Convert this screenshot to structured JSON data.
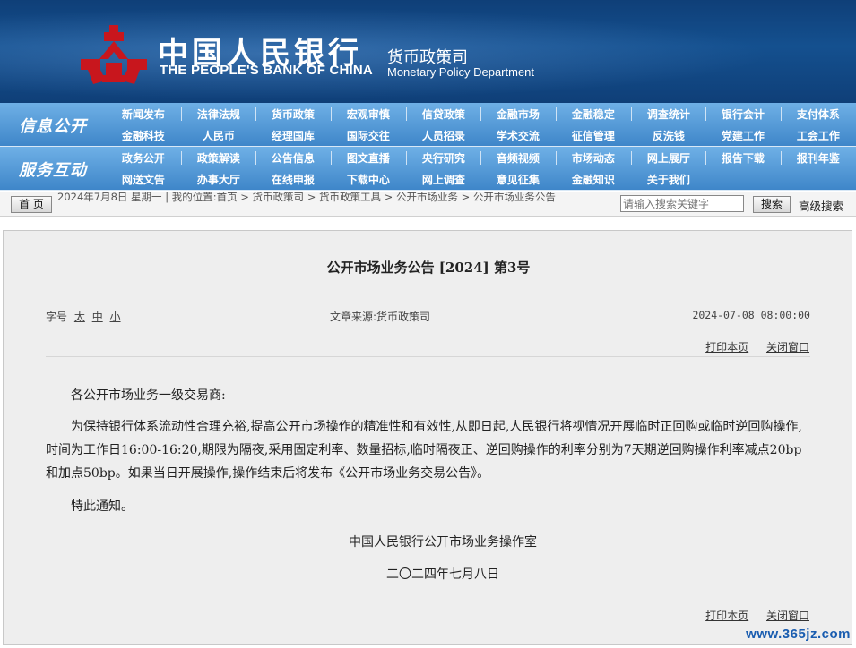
{
  "header": {
    "bank_name_cn": "中国人民银行",
    "bank_name_en": "THE PEOPLE'S BANK OF CHINA",
    "dept_name_cn": "货币政策司",
    "dept_name_en": "Monetary Policy Department",
    "logo_icon": "pboc-logo-icon",
    "brand_color": "#0f3f78",
    "logo_color": "#c8161d"
  },
  "nav": {
    "section_1_title": "信息公开",
    "section_2_title": "服务互动",
    "section_1_row_1": [
      "新闻发布",
      "法律法规",
      "货币政策",
      "宏观审慎",
      "信贷政策",
      "金融市场",
      "金融稳定",
      "调查统计",
      "银行会计",
      "支付体系"
    ],
    "section_1_row_2": [
      "金融科技",
      "人民币",
      "经理国库",
      "国际交往",
      "人员招录",
      "学术交流",
      "征信管理",
      "反洗钱",
      "党建工作",
      "工会工作"
    ],
    "section_2_row_1": [
      "政务公开",
      "政策解读",
      "公告信息",
      "图文直播",
      "央行研究",
      "音频视频",
      "市场动态",
      "网上展厅",
      "报告下载",
      "报刊年鉴"
    ],
    "section_2_row_2": [
      "网送文告",
      "办事大厅",
      "在线申报",
      "下载中心",
      "网上调查",
      "意见征集",
      "金融知识",
      "关于我们"
    ]
  },
  "breadcrumb": {
    "home_label": "首 页",
    "text": "2024年7月8日 星期一 | 我的位置:首页 > 货币政策司 > 货币政策工具 > 公开市场业务 > 公开市场业务公告",
    "search_placeholder": "请输入搜索关键字",
    "search_button": "搜索",
    "advanced_search": "高级搜索"
  },
  "article": {
    "title": "公开市场业务公告 [2024] 第3号",
    "font_size_label": "字号",
    "font_sizes": [
      "太",
      "中",
      "小"
    ],
    "source": "文章来源:货币政策司",
    "publish_time": "2024-07-08 08:00:00",
    "print_label": "打印本页",
    "close_label": "关闭窗口",
    "salutation": "各公开市场业务一级交易商:",
    "paragraph_1": "为保持银行体系流动性合理充裕,提高公开市场操作的精准性和有效性,从即日起,人民银行将视情况开展临时正回购或临时逆回购操作,时间为工作日16:00-16:20,期限为隔夜,采用固定利率、数量招标,临时隔夜正、逆回购操作的利率分别为7天期逆回购操作利率减点20bp和加点50bp。如果当日开展操作,操作结束后将发布《公开市场业务交易公告》。",
    "notice": "特此通知。",
    "signature": "中国人民银行公开市场业务操作室",
    "date": "二〇二四年七月八日"
  },
  "watermark": "www.365jz.com"
}
